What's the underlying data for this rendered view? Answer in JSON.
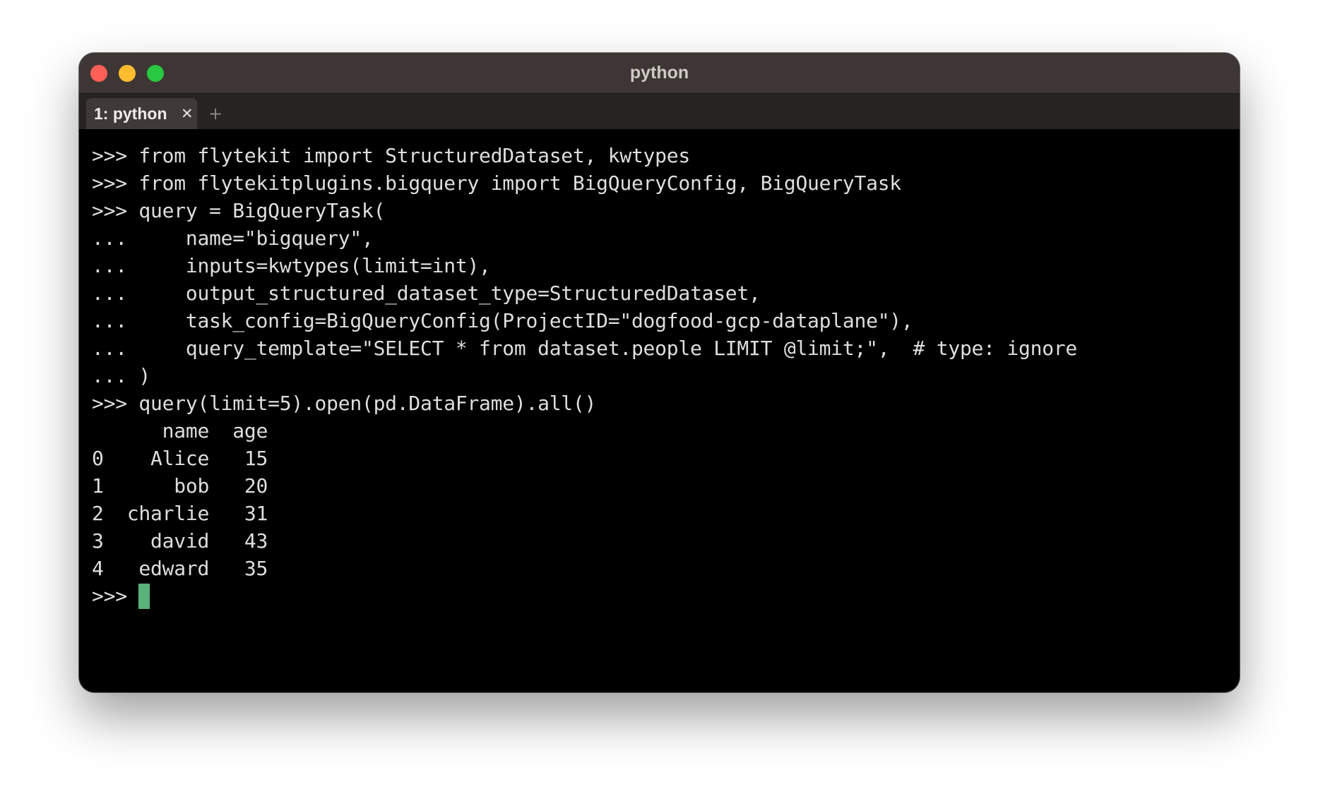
{
  "window": {
    "title": "python",
    "traffic_lights": {
      "close_color": "#fe5f57",
      "minimize_color": "#febc2e",
      "maximize_color": "#28c840"
    }
  },
  "tabs": [
    {
      "label": "1: python",
      "close_icon": "close-icon"
    }
  ],
  "new_tab_icon": "plus-icon",
  "new_tab_glyph": "+",
  "tab_close_glyph": "✕",
  "terminal": {
    "background": "#000000",
    "text_color": "#dedede",
    "cursor_color": "#58b27a",
    "lines": [
      ">>> from flytekit import StructuredDataset, kwtypes",
      ">>> from flytekitplugins.bigquery import BigQueryConfig, BigQueryTask",
      ">>> query = BigQueryTask(",
      "...     name=\"bigquery\",",
      "...     inputs=kwtypes(limit=int),",
      "...     output_structured_dataset_type=StructuredDataset,",
      "...     task_config=BigQueryConfig(ProjectID=\"dogfood-gcp-dataplane\"),",
      "...     query_template=\"SELECT * from dataset.people LIMIT @limit;\",  # type: ignore",
      "... )",
      ">>> query(limit=5).open(pd.DataFrame).all()",
      "      name  age",
      "0    Alice   15",
      "1      bob   20",
      "2  charlie   31",
      "3    david   43",
      "4   edward   35"
    ],
    "prompt": ">>> "
  }
}
